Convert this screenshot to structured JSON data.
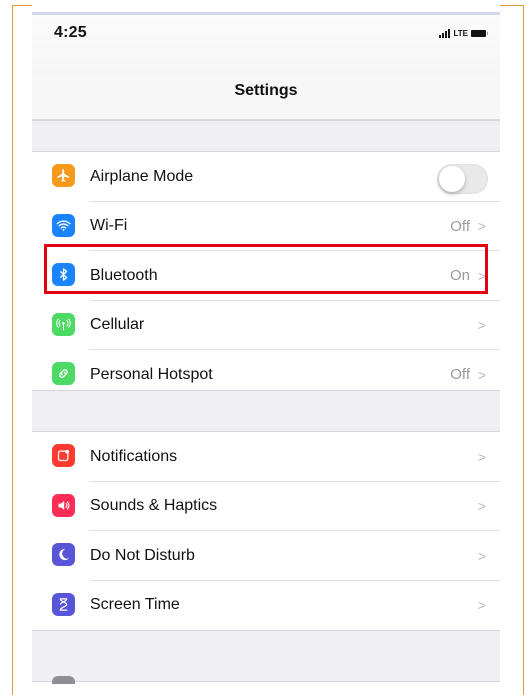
{
  "status_bar": {
    "time": "4:25",
    "network": "LTE"
  },
  "nav": {
    "title": "Settings"
  },
  "groups": [
    {
      "rows": [
        {
          "label": "Airplane Mode",
          "value": "",
          "icon": "airplane-icon",
          "color": "#f79a1b",
          "toggle": true,
          "toggle_on": false
        },
        {
          "label": "Wi-Fi",
          "value": "Off",
          "icon": "wifi-icon",
          "color": "#1a84ff"
        },
        {
          "label": "Bluetooth",
          "value": "On",
          "icon": "bluetooth-icon",
          "color": "#1a84ff",
          "highlighted": true
        },
        {
          "label": "Cellular",
          "value": "",
          "icon": "cellular-icon",
          "color": "#4cd964"
        },
        {
          "label": "Personal Hotspot",
          "value": "Off",
          "icon": "hotspot-icon",
          "color": "#4cd964"
        }
      ]
    },
    {
      "rows": [
        {
          "label": "Notifications",
          "value": "",
          "icon": "notifications-icon",
          "color": "#ff3b30"
        },
        {
          "label": "Sounds & Haptics",
          "value": "",
          "icon": "sounds-icon",
          "color": "#ff2d55"
        },
        {
          "label": "Do Not Disturb",
          "value": "",
          "icon": "moon-icon",
          "color": "#5856d6"
        },
        {
          "label": "Screen Time",
          "value": "",
          "icon": "hourglass-icon",
          "color": "#5856d6"
        }
      ]
    }
  ],
  "highlight_color": "#e3000f",
  "frame_color": "#e39a3b"
}
